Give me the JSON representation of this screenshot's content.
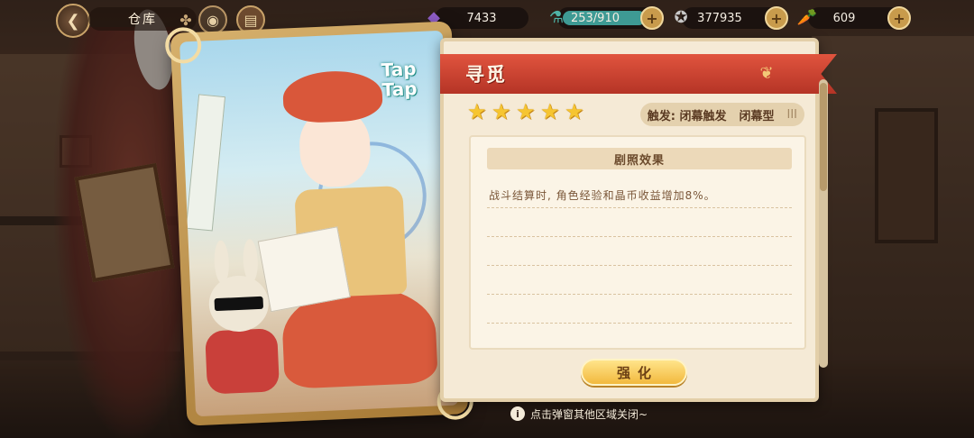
{
  "topbar": {
    "title": "仓库",
    "resources": [
      {
        "name": "gem",
        "icon": "◆",
        "value": "7433"
      },
      {
        "name": "stamina",
        "icon": "⚗",
        "value": "253/910",
        "fill_fraction": 0.28
      },
      {
        "name": "coin",
        "icon": "✪",
        "value": "377935"
      },
      {
        "name": "carrot",
        "icon": "🥕",
        "value": "609"
      }
    ],
    "plus_label": "+"
  },
  "card": {
    "logo_text": "Tap Tap"
  },
  "panel": {
    "title": "寻觅",
    "stars": 5,
    "star_glyph": "★",
    "trigger_label": "触发: 闭幕触发",
    "type_label": "闭幕型",
    "type_level": "III",
    "effect_header": "剧照效果",
    "effect_text": "战斗结算时, 角色经验和晶币收益增加8%。",
    "upgrade_button": "强化"
  },
  "hint": {
    "icon": "i",
    "text": "点击弹窗其他区域关闭~"
  },
  "colors": {
    "ribbon": "#d8472f",
    "panel_bg": "#f5ead6",
    "star": "#f6c531",
    "button": "#f2b93e"
  }
}
